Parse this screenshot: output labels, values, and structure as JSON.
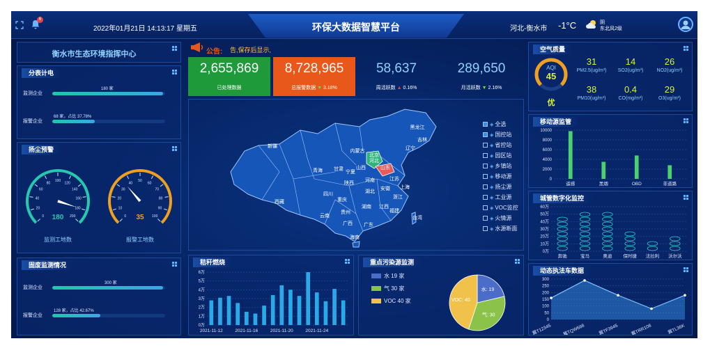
{
  "header": {
    "title": "环保大数据智慧平台",
    "datetime": "2022年01月21日 14:13:17 星期五",
    "location": "河北-衡水市",
    "temperature": "-1°C",
    "weather_cond": "阴",
    "weather_wind": "东北风2级",
    "notif_count": "6"
  },
  "left": {
    "center_title": "衡水市生态环境指挥中心",
    "meter": {
      "title": "分表计电",
      "rows": [
        {
          "label": "监测企业",
          "text": "180 家",
          "fill": 0.98
        },
        {
          "label": "报警企业",
          "text": "68 家，占比 37.78%",
          "fill": 0.3778
        }
      ]
    },
    "dust": {
      "title": "扬尘预警",
      "gauges": [
        {
          "value": "180",
          "label": "监测工地数",
          "ticks": [
            "0",
            "20",
            "40",
            "60",
            "80",
            "100",
            "120",
            "140",
            "160",
            "180",
            "200"
          ]
        },
        {
          "value": "35",
          "label": "报警工地数",
          "ticks": [
            "0",
            "10",
            "20",
            "30",
            "40",
            "50",
            "60",
            "70",
            "80",
            "90",
            "100"
          ]
        }
      ]
    },
    "solid": {
      "title": "固废监测情况",
      "rows": [
        {
          "label": "监测企业",
          "text": "300 家",
          "fill": 0.98
        },
        {
          "label": "报警企业",
          "text": "128 家，占比 42.67%",
          "fill": 0.4267
        }
      ]
    }
  },
  "notice": {
    "label": "公告:",
    "text": "告,保存后显示,"
  },
  "kpis": [
    {
      "value": "2,655,869",
      "label": "已处理数据",
      "bg": "#1e9a3a"
    },
    {
      "value": "8,728,965",
      "label": "总报警数据",
      "change": "3.18%",
      "dir": "down",
      "bg": "#e8581a"
    },
    {
      "value": "58,637",
      "label": "周活跃数",
      "change": "0.16%",
      "dir": "up",
      "bg": ""
    },
    {
      "value": "289,650",
      "label": "月活跃数",
      "change": "2.16%",
      "dir": "down",
      "bg": ""
    }
  ],
  "map": {
    "provinces": [
      "黑龙江",
      "吉林",
      "辽宁",
      "新疆",
      "内蒙古",
      "北京",
      "山西",
      "山东",
      "河北",
      "青海",
      "甘肃",
      "宁夏",
      "陕西",
      "河南",
      "江苏",
      "西藏",
      "四川",
      "重庆",
      "湖北",
      "安徽",
      "上海",
      "浙江",
      "湖南",
      "江西",
      "贵州",
      "云南",
      "福建",
      "广西",
      "广东",
      "台湾",
      "海南"
    ],
    "legend": [
      "全选",
      "国控站",
      "省控站",
      "园区站",
      "乡镇站",
      "移动源",
      "扬尘源",
      "工业源",
      "VOC监控",
      "火情源",
      "水源断面"
    ]
  },
  "straw": {
    "title": "秸秆燃烧",
    "chart_data": {
      "type": "bar",
      "categories": [
        "2021-11-12",
        "2021-11-13",
        "2021-11-14",
        "2021-11-15",
        "2021-11-16",
        "2021-11-17",
        "2021-11-18",
        "2021-11-19",
        "2021-11-20",
        "2021-11-21",
        "2021-11-22",
        "2021-11-23",
        "2021-11-24",
        "2021-11-25",
        "2021-11-26",
        "2021-11-27"
      ],
      "tick_labels": [
        "2021-11-12",
        "2021-11-16",
        "2021-11-20",
        "2021-11-24"
      ],
      "values": [
        28000,
        31000,
        33000,
        25000,
        15000,
        13000,
        22000,
        34000,
        45000,
        40000,
        33000,
        60000,
        37000,
        27000,
        41000,
        28000
      ],
      "yticks": [
        "0万",
        "1万",
        "2万",
        "3万",
        "4万",
        "5万",
        "6万"
      ],
      "ylim": [
        0,
        60000
      ]
    }
  },
  "pollution": {
    "title": "重点污染源监测",
    "chart_data": {
      "type": "pie",
      "slices": [
        {
          "name": "水",
          "count": "19",
          "legend": "水 19 家",
          "label": "水: 19",
          "value": 19,
          "color": "#4b6cc8"
        },
        {
          "name": "气",
          "count": "30",
          "legend": "气 30 家",
          "label": "气: 30",
          "value": 30,
          "color": "#8bc34a"
        },
        {
          "name": "VOC",
          "count": "40",
          "legend": "VOC 40 家",
          "label": "VOC: 40",
          "value": 40,
          "color": "#f0c24a"
        }
      ]
    }
  },
  "air": {
    "title": "空气质量",
    "aqi_label": "AQI",
    "aqi": "45",
    "aqi_fraction": 0.75,
    "level": "优",
    "items": [
      {
        "v": "31",
        "l": "PM2.5(ug/m³)"
      },
      {
        "v": "14",
        "l": "SO2(ug/m³)"
      },
      {
        "v": "26",
        "l": "NO2(ug/m³)"
      },
      {
        "v": "38",
        "l": "PM10(ug/m³)"
      },
      {
        "v": "0.4",
        "l": "CO(mg/m³)"
      },
      {
        "v": "29",
        "l": "O3(ug/m³)"
      }
    ]
  },
  "mobile": {
    "title": "移动源监管",
    "chart_data": {
      "type": "bar",
      "categories": [
        "遥感",
        "黑烟",
        "OBD",
        "非道路"
      ],
      "values": [
        9800,
        3500,
        4800,
        2800
      ],
      "yticks": [
        "0",
        "2000",
        "4000",
        "6000",
        "8000",
        "10000"
      ],
      "ylim": [
        0,
        10000
      ]
    }
  },
  "city": {
    "title": "城管数字化监控",
    "chart_data": {
      "type": "bar",
      "categories": [
        "奔驰",
        "宝马",
        "奥迪",
        "保时捷",
        "法拉利",
        "沃尔沃"
      ],
      "values": [
        480000,
        500000,
        520000,
        250000,
        160000,
        210000
      ],
      "yticks": [
        "0万",
        "10万",
        "20万",
        "30万",
        "40万",
        "50万",
        "60万"
      ],
      "ylim": [
        0,
        600000
      ]
    }
  },
  "enforce": {
    "title": "动态执法车数据",
    "chart_data": {
      "type": "area",
      "categories": [
        "冀T12345",
        "冀TQW668",
        "冀TF3945",
        "冀TRR108",
        "冀TL36K"
      ],
      "values": [
        160,
        290,
        180,
        80,
        180
      ],
      "yticks": [
        "0",
        "50",
        "100",
        "150",
        "200",
        "250",
        "300"
      ],
      "ylim": [
        0,
        300
      ]
    }
  }
}
